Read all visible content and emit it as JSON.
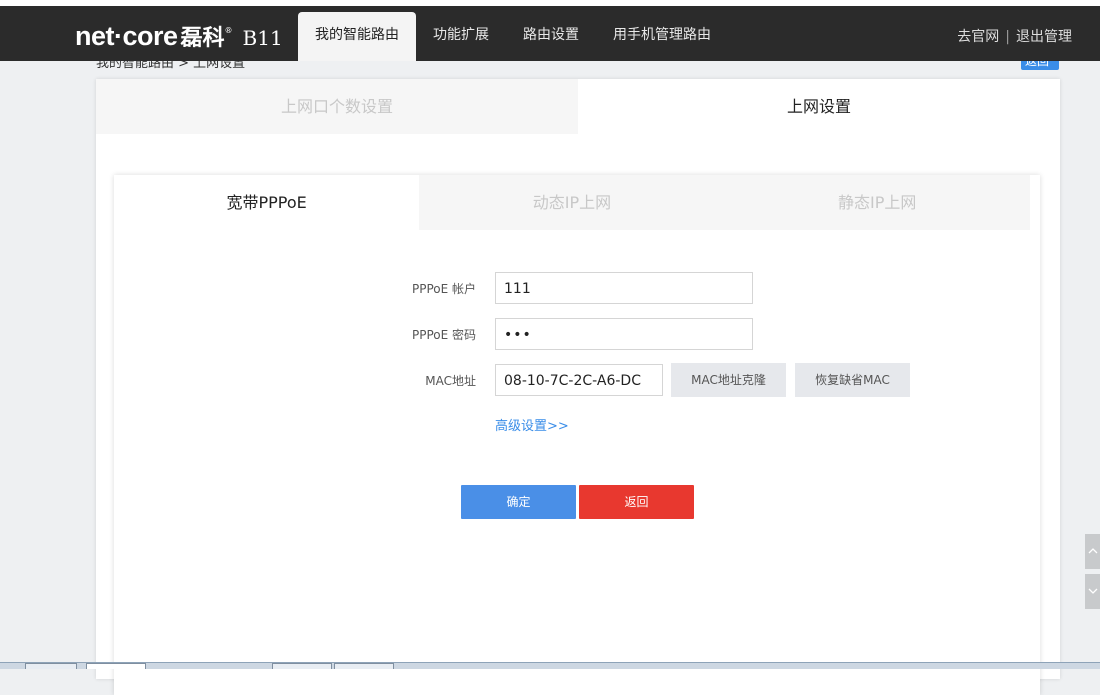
{
  "header": {
    "brand_logo": "net·core",
    "brand_logo_cn": "磊科",
    "brand_reg": "®",
    "model": "B11",
    "nav": [
      {
        "label": "我的智能路由",
        "active": true
      },
      {
        "label": "功能扩展",
        "active": false
      },
      {
        "label": "路由设置",
        "active": false
      },
      {
        "label": "用手机管理路由",
        "active": false
      }
    ],
    "links": {
      "official_site": "去官网",
      "separator": "|",
      "logout": "退出管理"
    }
  },
  "breadcrumb": "我的智能路由 > 上网设置",
  "back_top_label": "返回",
  "outer_tabs": [
    {
      "label": "上网口个数设置",
      "active": false
    },
    {
      "label": "上网设置",
      "active": true
    }
  ],
  "inner_tabs": [
    {
      "label": "宽带PPPoE",
      "active": true
    },
    {
      "label": "动态IP上网",
      "active": false
    },
    {
      "label": "静态IP上网",
      "active": false
    }
  ],
  "form": {
    "account_label": "PPPoE 帐户",
    "account_value": "111",
    "password_label": "PPPoE 密码",
    "password_value": "•••",
    "mac_label": "MAC地址",
    "mac_value": "08-10-7C-2C-A6-DC",
    "mac_clone_button": "MAC地址克隆",
    "mac_restore_button": "恢复缺省MAC",
    "advanced_link": "高级设置>>",
    "confirm_button": "确定",
    "back_button": "返回"
  },
  "colors": {
    "header_bg": "#2b2b2b",
    "primary_blue": "#4a8fe7",
    "danger_red": "#e8382f",
    "link_blue": "#3a8de8"
  }
}
